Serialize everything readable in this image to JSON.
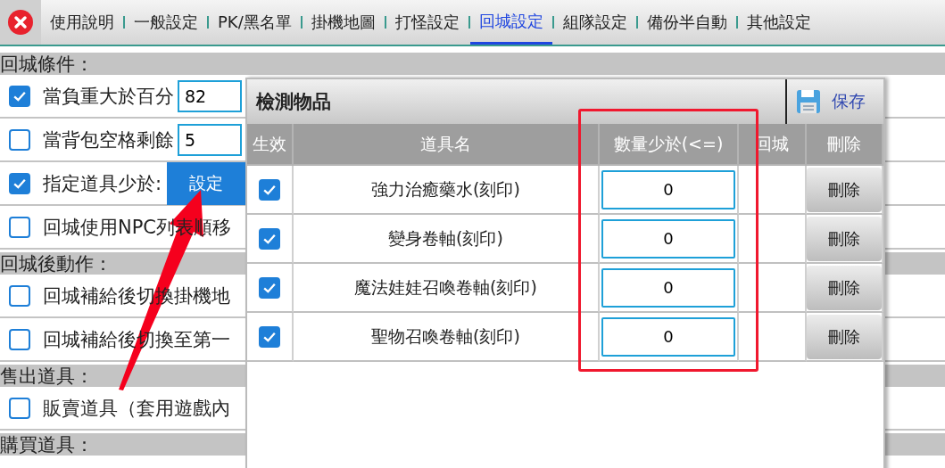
{
  "tabs": [
    {
      "label": "使用說明",
      "selected": false
    },
    {
      "label": "一般設定",
      "selected": false
    },
    {
      "label": "PK/黑名單",
      "selected": false
    },
    {
      "label": "掛機地圖",
      "selected": false
    },
    {
      "label": "打怪設定",
      "selected": false
    },
    {
      "label": "回城設定",
      "selected": true
    },
    {
      "label": "組隊設定",
      "selected": false
    },
    {
      "label": "備份半自動",
      "selected": false
    },
    {
      "label": "其他設定",
      "selected": false
    }
  ],
  "sections": [
    {
      "title": "回城條件：",
      "options": [
        {
          "label": "當負重大於百分",
          "checked": true,
          "kind": "input",
          "value": "82"
        },
        {
          "label": "當背包空格剩餘",
          "checked": false,
          "kind": "input",
          "value": "5"
        },
        {
          "label": "指定道具少於:",
          "checked": true,
          "kind": "button",
          "button": "設定"
        },
        {
          "label": "回城使用NPC列表順移",
          "checked": false,
          "kind": "plain"
        }
      ]
    },
    {
      "title": "回城後動作：",
      "options": [
        {
          "label": "回城補給後切換掛機地",
          "checked": false,
          "kind": "plain"
        },
        {
          "label": "回城補給後切換至第一",
          "checked": false,
          "kind": "plain"
        }
      ]
    },
    {
      "title": "售出道具：",
      "options": [
        {
          "label": "販賣道具（套用遊戲內",
          "checked": false,
          "kind": "plain"
        }
      ]
    },
    {
      "title": "購買道具："
    }
  ],
  "dialog": {
    "title": "檢測物品",
    "save": "保存",
    "columns": [
      "生效",
      "道具名",
      "數量少於(<=)",
      "回城",
      "刪除"
    ],
    "rows": [
      {
        "enabled": true,
        "name": "強力治癒藥水(刻印)",
        "quantity": "0",
        "delete": "刪除"
      },
      {
        "enabled": true,
        "name": "變身卷軸(刻印)",
        "quantity": "0",
        "delete": "刪除"
      },
      {
        "enabled": true,
        "name": "魔法娃娃召喚卷軸(刻印)",
        "quantity": "0",
        "delete": "刪除"
      },
      {
        "enabled": true,
        "name": "聖物召喚卷軸(刻印)",
        "quantity": "0",
        "delete": "刪除"
      }
    ]
  }
}
